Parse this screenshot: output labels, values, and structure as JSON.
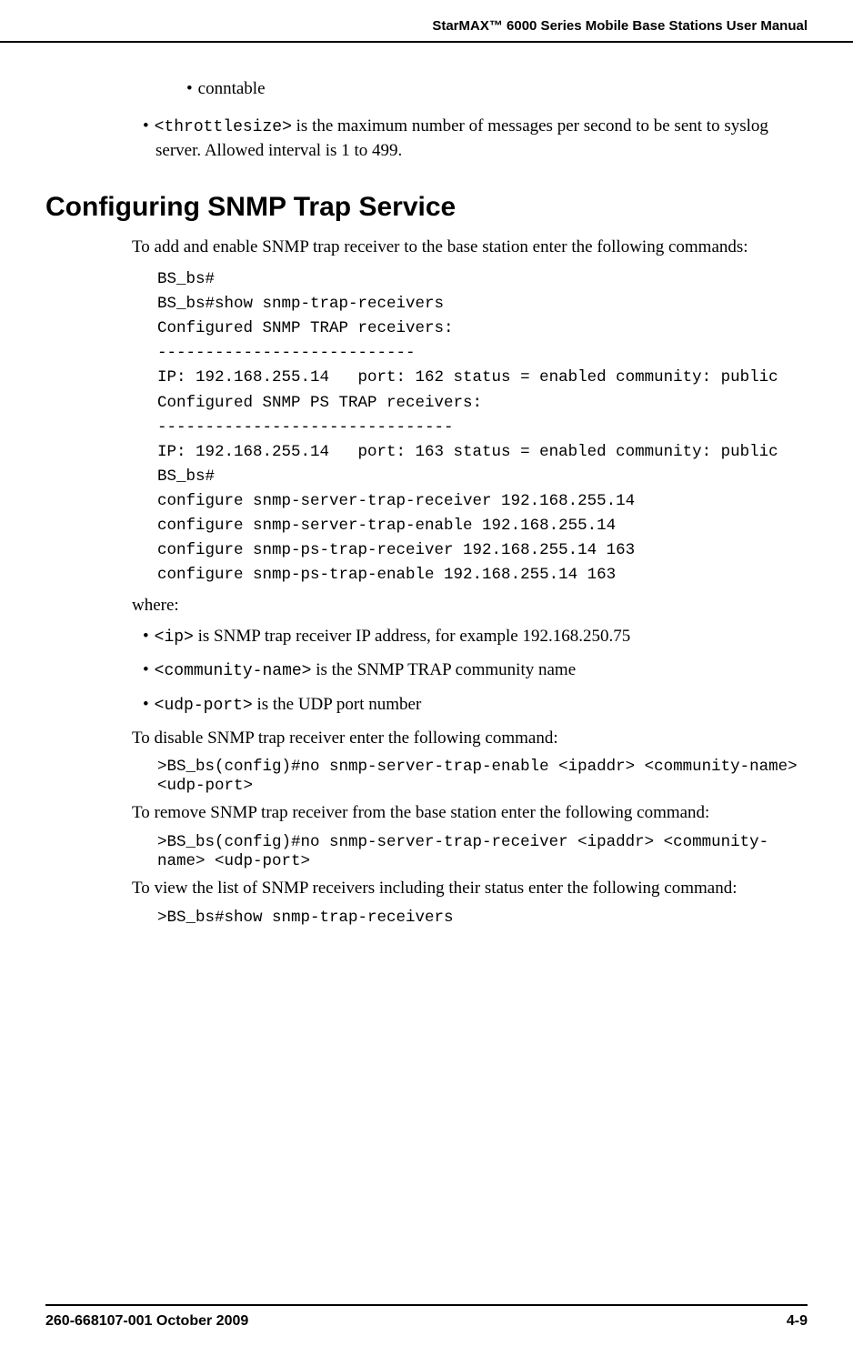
{
  "header": {
    "title": "StarMAX™ 6000 Series Mobile Base Stations User Manual"
  },
  "intro": {
    "sub_bullet": "conntable",
    "throttle_code": "<throttlesize>",
    "throttle_text": " is the maximum number of messages per second to be sent to syslog server. Allowed interval is 1 to 499."
  },
  "section": {
    "heading": "Configuring SNMP Trap Service",
    "intro_para": "To add and enable SNMP trap receiver to the base station enter the following commands:",
    "code1": "BS_bs#\nBS_bs#show snmp-trap-receivers\nConfigured SNMP TRAP receivers:\n---------------------------\nIP: 192.168.255.14   port: 162 status = enabled community: public\nConfigured SNMP PS TRAP receivers:\n-------------------------------\nIP: 192.168.255.14   port: 163 status = enabled community: public\nBS_bs#\nconfigure snmp-server-trap-receiver 192.168.255.14\nconfigure snmp-server-trap-enable 192.168.255.14\nconfigure snmp-ps-trap-receiver 192.168.255.14 163\nconfigure snmp-ps-trap-enable 192.168.255.14 163",
    "where": "where:",
    "bullets": [
      {
        "code": "<ip>",
        "text": " is SNMP trap receiver IP address, for example 192.168.250.75"
      },
      {
        "code": "<community-name>",
        "text": " is the SNMP TRAP community name"
      },
      {
        "code": "<udp-port>",
        "text": " is the UDP port number"
      }
    ],
    "para_disable": "To disable SNMP trap receiver enter the following command:",
    "code_disable": ">BS_bs(config)#no snmp-server-trap-enable <ipaddr> <community-name> <udp-port>",
    "para_remove": "To remove SNMP trap receiver from the base station enter the following command:",
    "code_remove": ">BS_bs(config)#no snmp-server-trap-receiver <ipaddr> <community-name> <udp-port>",
    "para_view": "To view the list of SNMP receivers including their status enter the following command:",
    "code_view": ">BS_bs#show snmp-trap-receivers"
  },
  "footer": {
    "left": "260-668107-001 October 2009",
    "right": "4-9"
  }
}
